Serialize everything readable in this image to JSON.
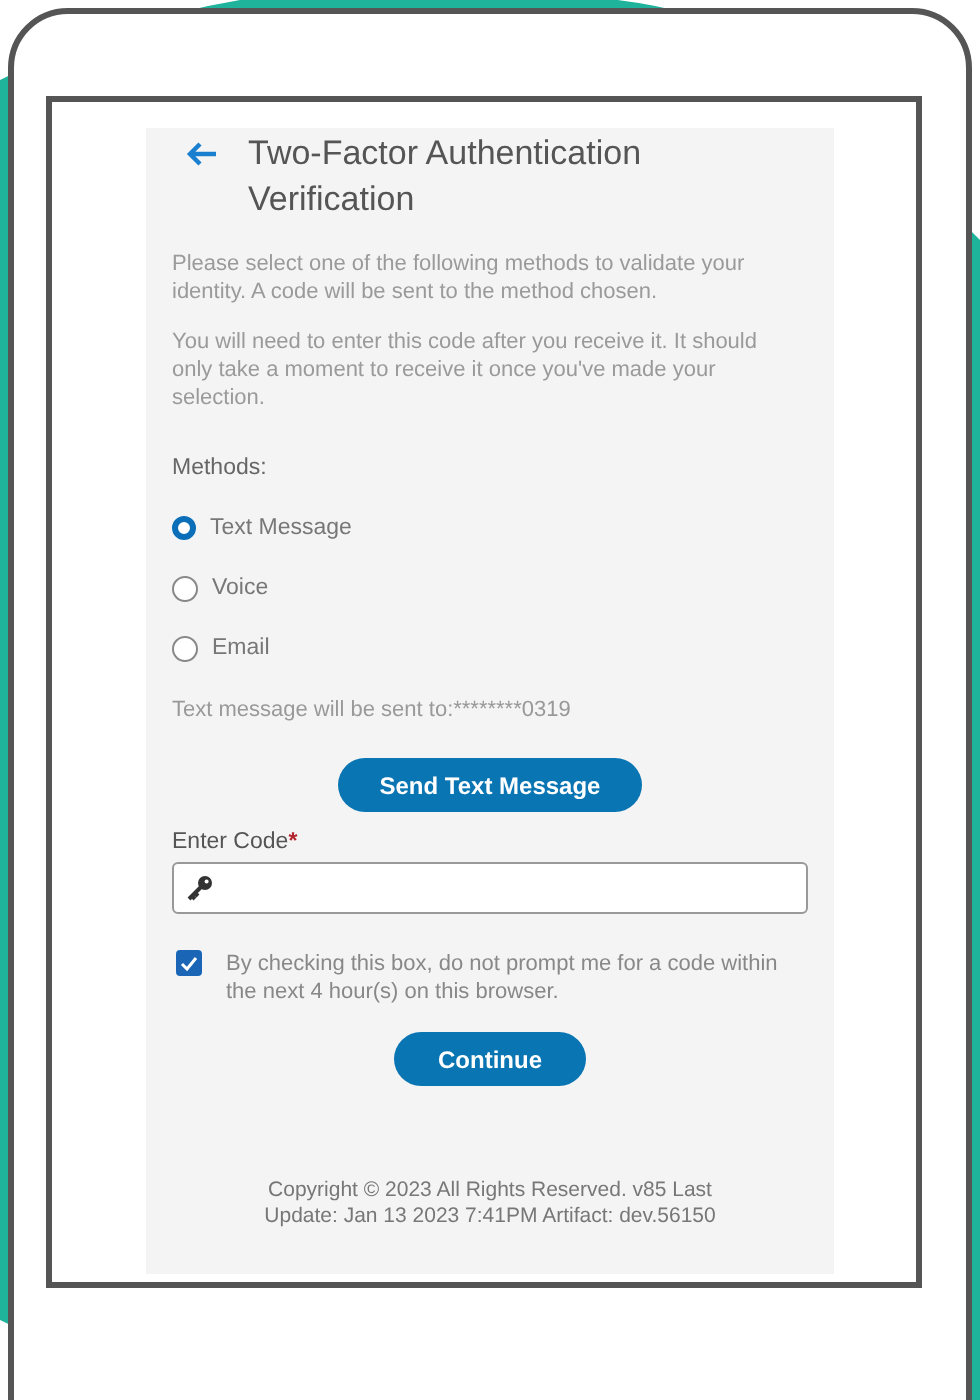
{
  "title": "Two-Factor Authentication Verification",
  "paragraphs": [
    "Please select one of the following methods to validate your identity. A code will be sent to the method chosen.",
    "You will need to enter this code after you receive it. It should only take a moment to receive it once you've made your selection."
  ],
  "methods_label": "Methods:",
  "methods": [
    {
      "label": "Text Message",
      "selected": true
    },
    {
      "label": "Voice",
      "selected": false
    },
    {
      "label": "Email",
      "selected": false
    }
  ],
  "send_notice": "Text message will be sent to:********0319",
  "send_button": "Send Text Message",
  "code_field": {
    "label": "Enter Code",
    "required_mark": "*"
  },
  "remember": {
    "label": "By checking this box, do not prompt me for a code within the next 4 hour(s) on this browser.",
    "checked": true
  },
  "continue_button": "Continue",
  "footer": "Copyright © 2023 All Rights Reserved. v85 Last Update: Jan 13 2023 7:41PM Artifact: dev.56150"
}
